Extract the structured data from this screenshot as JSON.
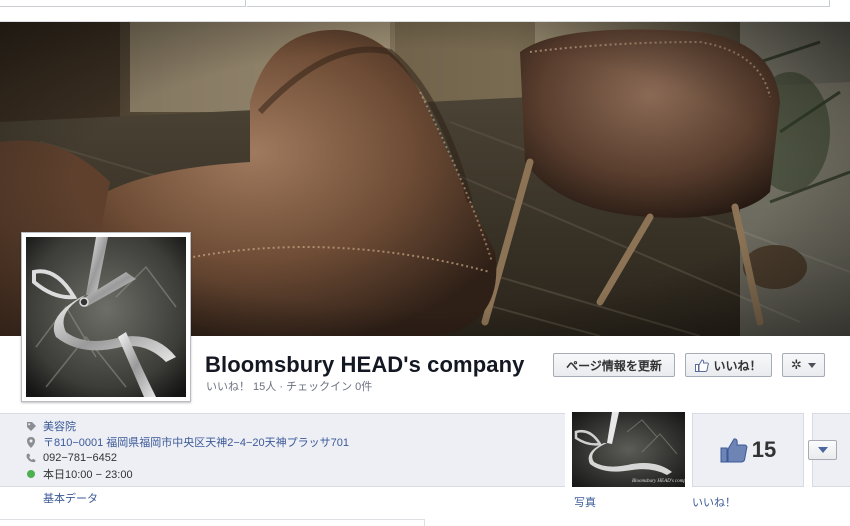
{
  "page": {
    "name": "Bloomsbury HEAD's company",
    "subtitle": "いいね！ 15人 · チェックイン 0件"
  },
  "actions": {
    "update_label": "ページ情報を更新",
    "like_label": "いいね！",
    "gear_label": "✲"
  },
  "info": {
    "category": "美容院",
    "address": "〒810−0001 福岡県福岡市中央区天神2−4−20天神プラッサ701",
    "phone": "092−781−6452",
    "hours": "本日10:00 − 23:00",
    "basic_data_link": "基本データ"
  },
  "tiles": {
    "photo_label": "写真",
    "likes_count": "15",
    "likes_label": "いいね！"
  },
  "icons": {
    "category": "tag-icon",
    "address": "map-pin-icon",
    "phone": "phone-icon",
    "hours": "open-status-dot-icon",
    "like": "thumbs-up-icon",
    "gear": "gear-icon"
  },
  "colors": {
    "link": "#3b5998",
    "panel": "#edeff4",
    "open_status": "#4caf50"
  }
}
